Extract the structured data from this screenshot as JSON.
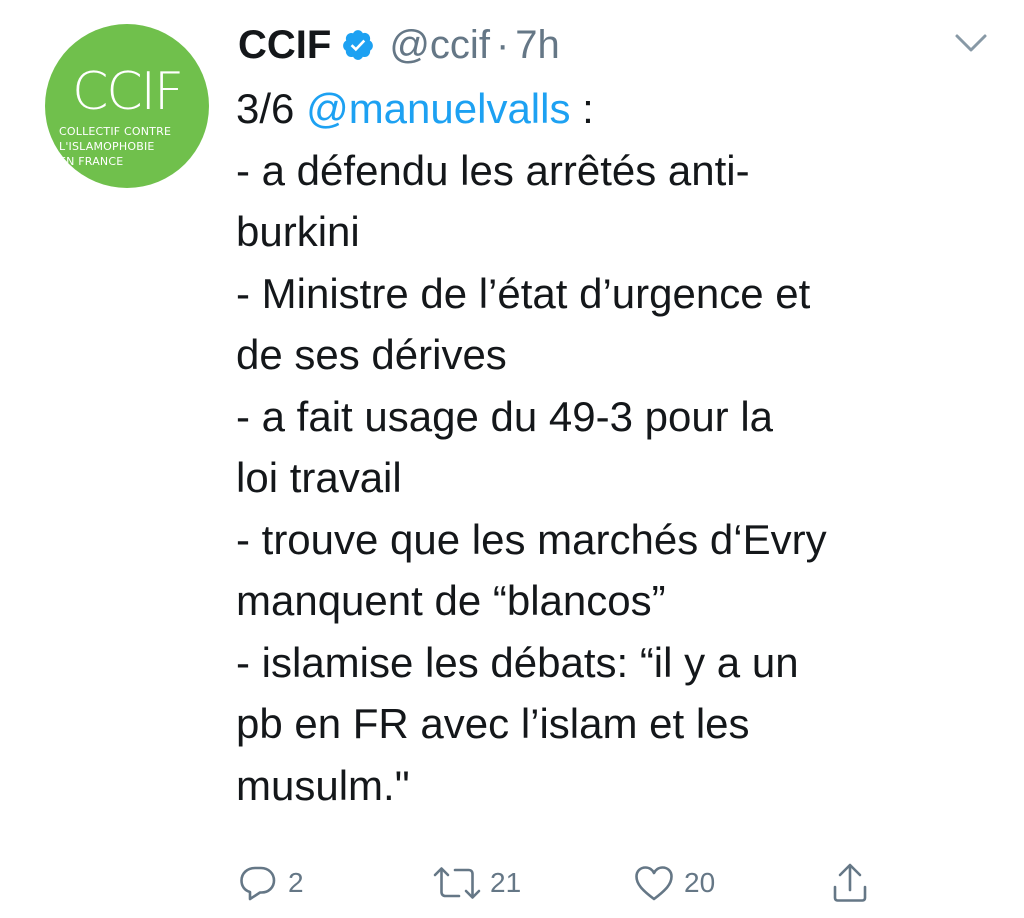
{
  "tweet": {
    "avatar": {
      "mark": "CCIF",
      "lines": [
        "COLLECTIF CONTRE",
        "L'ISLAMOPHOBIE",
        "EN FRANCE"
      ],
      "color": "#70c04c"
    },
    "display_name": "CCIF",
    "handle": "@ccif",
    "separator": "·",
    "time": "7h",
    "body": {
      "lines": [
        {
          "prefix": "3/6 ",
          "mention": "@manuelvalls",
          "suffix": " :"
        },
        {
          "text": "- a défendu les arrêtés anti-"
        },
        {
          "text": "burkini"
        },
        {
          "text": "- Ministre de l’état d’urgence et"
        },
        {
          "text": "de ses dérives"
        },
        {
          "text": "- a fait usage du 49-3 pour la"
        },
        {
          "text": "loi travail"
        },
        {
          "text": "- trouve que les marchés d‘Evry"
        },
        {
          "text": "manquent de “blancos”"
        },
        {
          "text": "- islamise les débats: “il y a un"
        },
        {
          "text": "pb en FR avec l’islam et les"
        },
        {
          "text": "musulm.\""
        }
      ]
    },
    "actions": {
      "reply_count": "2",
      "retweet_count": "21",
      "like_count": "20"
    }
  },
  "colors": {
    "link": "#1da1f2",
    "secondary_text": "#657786",
    "primary_text": "#14171a",
    "verified": "#1da1f2"
  },
  "icons": [
    "verified-badge-icon",
    "chevron-down-icon",
    "reply-icon",
    "retweet-icon",
    "like-icon",
    "share-icon"
  ]
}
